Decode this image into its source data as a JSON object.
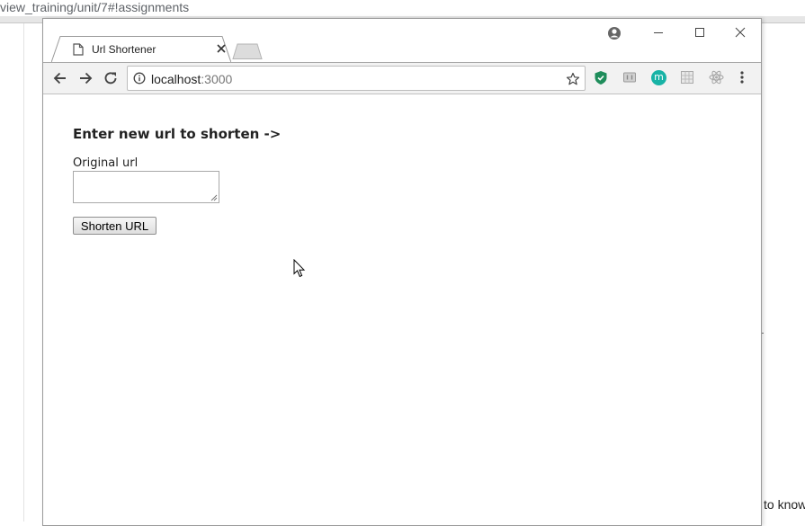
{
  "background": {
    "url_fragment": "view_training/unit/7#!assignments",
    "tail_text": "to know"
  },
  "browser": {
    "tab": {
      "title": "Url Shortener",
      "favicon": "page-icon"
    },
    "omnibox": {
      "host": "localhost",
      "port": ":3000"
    },
    "extensions": [
      "shield-icon",
      "film-icon",
      "m-avatar-icon",
      "grid-icon",
      "react-icon"
    ],
    "extension_letter": "m",
    "colors": {
      "shield": "#1f8d5b",
      "m_avatar": "#18b3a6"
    }
  },
  "page": {
    "heading": "Enter new url to shorten ->",
    "field_label": "Original url",
    "field_value": "",
    "button_label": "Shorten URL"
  }
}
